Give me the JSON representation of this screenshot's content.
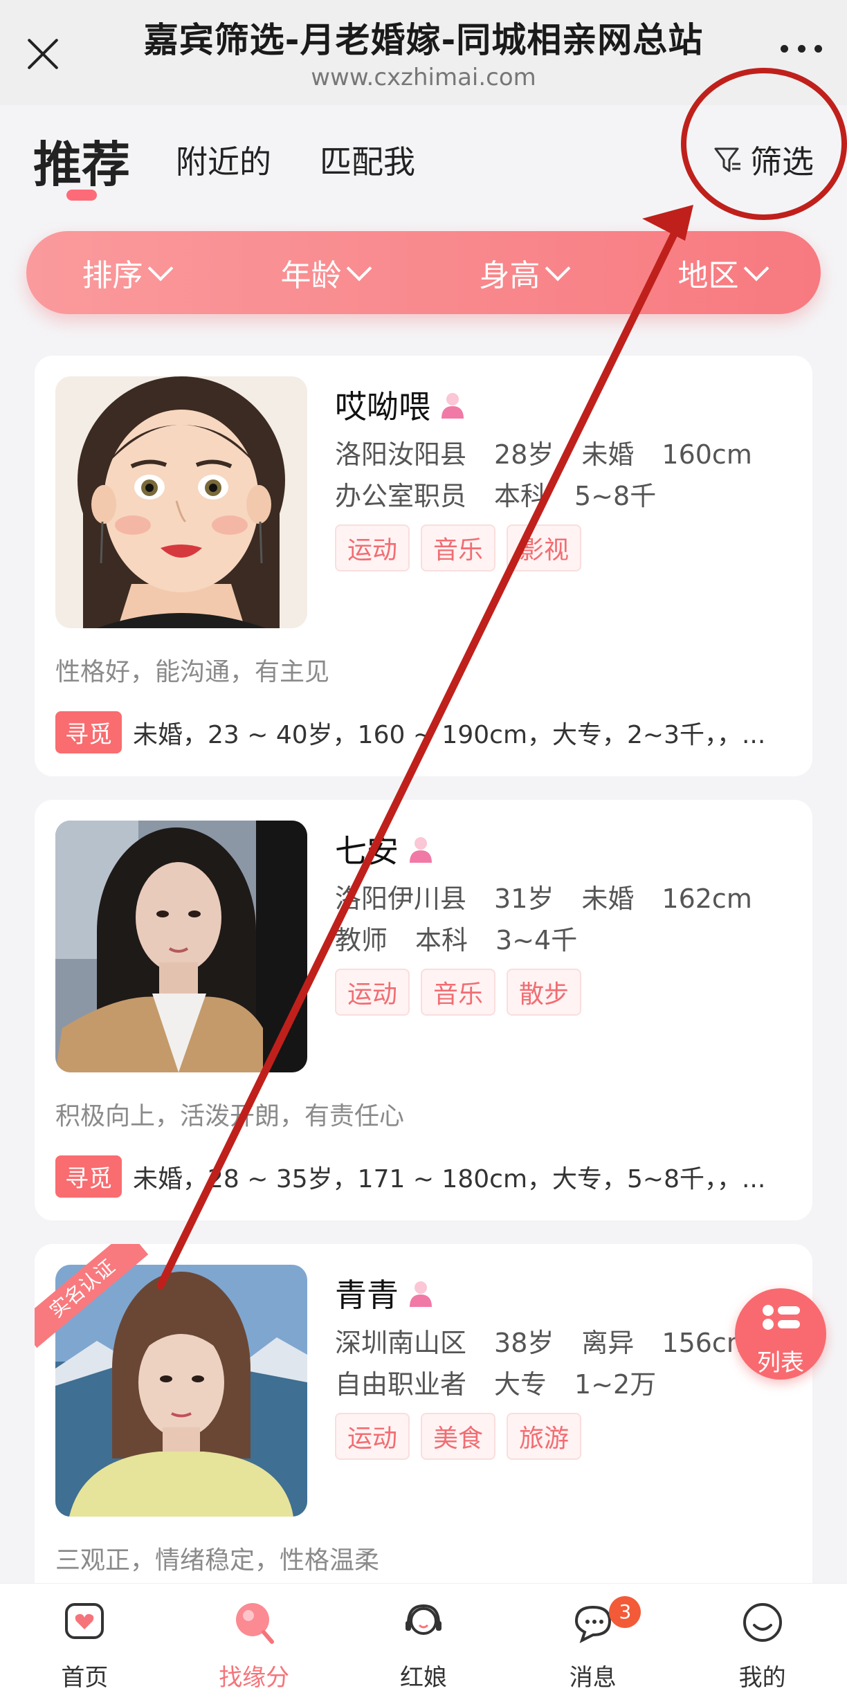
{
  "browser": {
    "title": "嘉宾筛选-月老婚嫁-同城相亲网总站",
    "url": "www.cxzhimai.com"
  },
  "tabs": {
    "recommend": "推荐",
    "nearby": "附近的",
    "match_me": "匹配我",
    "filter": "筛选"
  },
  "sort_bar": [
    "排序",
    "年龄",
    "身高",
    "地区"
  ],
  "profiles": [
    {
      "name": "哎呦喂",
      "location": "洛阳汝阳县",
      "age": "28岁",
      "marital": "未婚",
      "height": "160cm",
      "job": "办公室职员",
      "education": "本科",
      "income": "5~8千",
      "tags": [
        "运动",
        "音乐",
        "影视"
      ],
      "bio": "性格好，能沟通，有主见",
      "seek_label": "寻觅",
      "seek": "未婚，23 ~ 40岁，160 ~ 190cm，大专，2~3千，，..."
    },
    {
      "name": "七安",
      "location": "洛阳伊川县",
      "age": "31岁",
      "marital": "未婚",
      "height": "162cm",
      "job": "教师",
      "education": "本科",
      "income": "3~4千",
      "tags": [
        "运动",
        "音乐",
        "散步"
      ],
      "bio": "积极向上，活泼开朗，有责任心",
      "seek_label": "寻觅",
      "seek": "未婚，28 ~ 35岁，171 ~ 180cm，大专，5~8千，，..."
    },
    {
      "name": "青青",
      "verified": "实名认证",
      "location": "深圳南山区",
      "age": "38岁",
      "marital": "离异",
      "height": "156cm",
      "job": "自由职业者",
      "education": "大专",
      "income": "1~2万",
      "tags": [
        "运动",
        "美食",
        "旅游"
      ],
      "bio": "三观正，情绪稳定，性格温柔"
    }
  ],
  "fab": {
    "label": "列表",
    "icon": "list-icon"
  },
  "bottom_nav": {
    "home": "首页",
    "find": "找缘分",
    "matchmaker": "红娘",
    "messages": "消息",
    "messages_badge": "3",
    "mine": "我的"
  },
  "colors": {
    "accent": "#f86a6f",
    "annotation": "#c0201b"
  }
}
